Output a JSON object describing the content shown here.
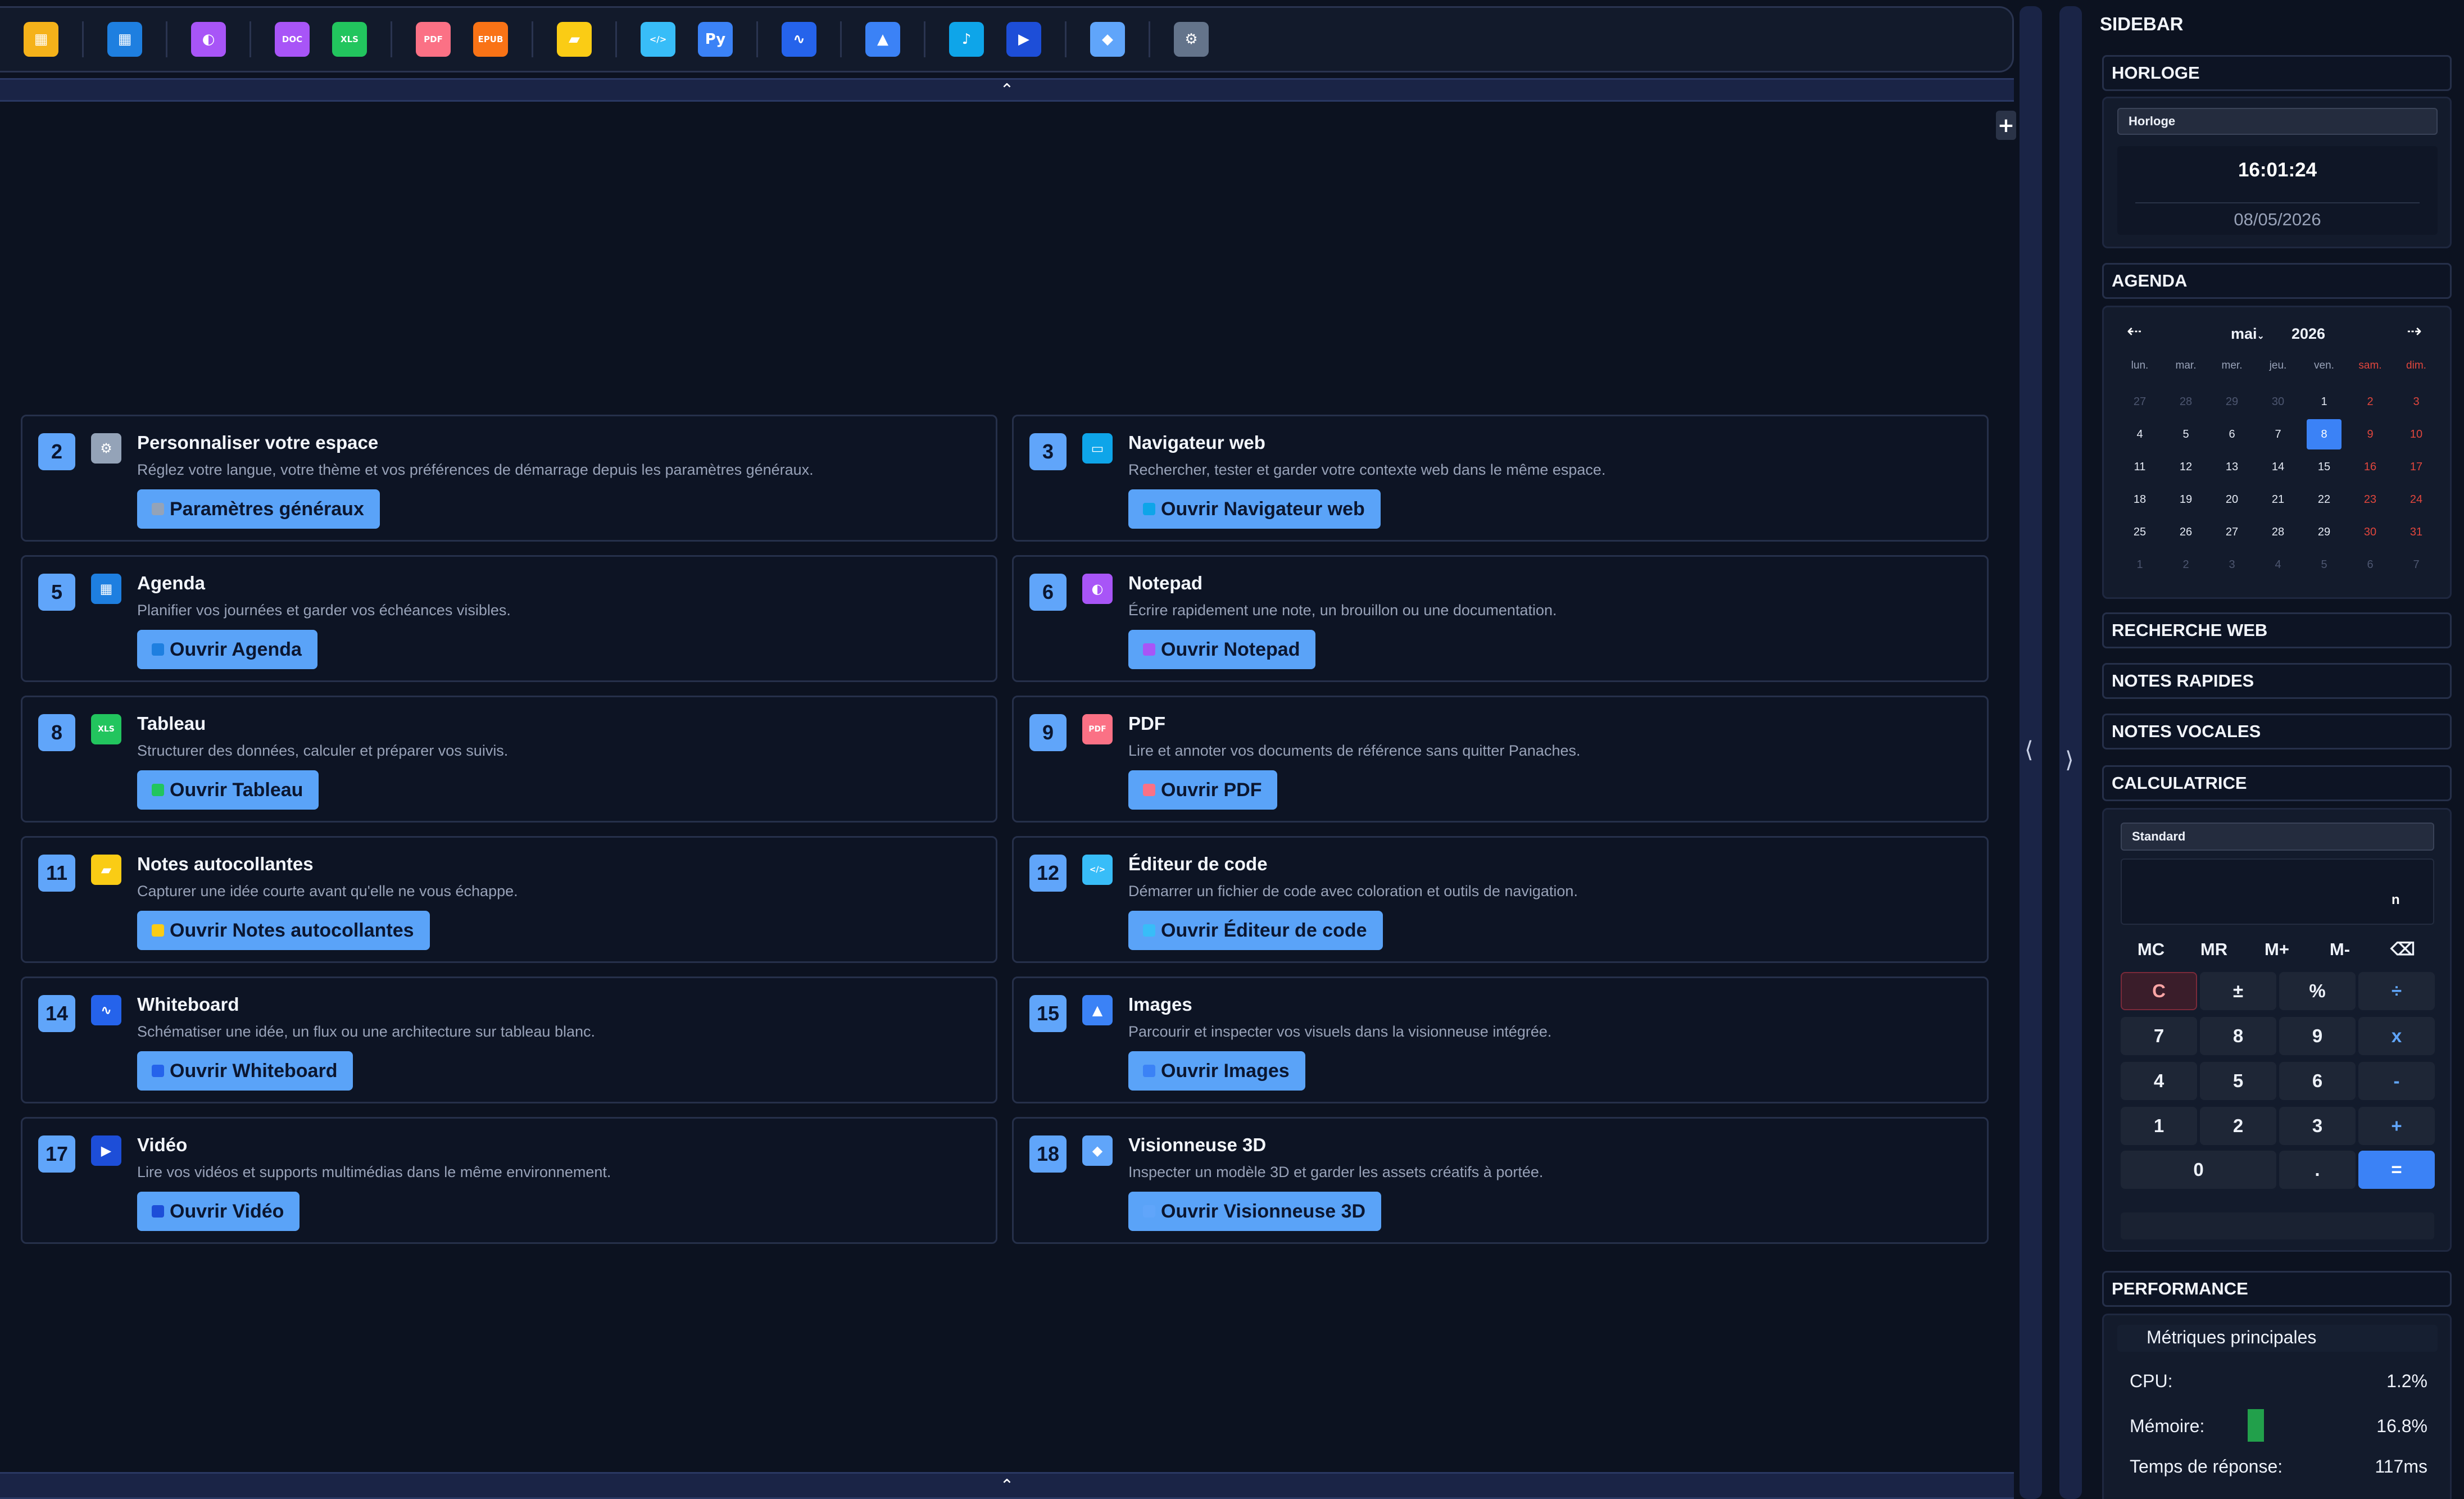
{
  "toolbar": {
    "icons": [
      {
        "name": "dashboard-app-icon",
        "glyph": "▦",
        "color": "#f5b21a"
      },
      {
        "name": "calendar-app-icon",
        "glyph": "▦",
        "color": "#1e7fe0"
      },
      {
        "name": "notepad-app-icon",
        "glyph": "◐",
        "color": "#a855f7"
      },
      {
        "name": "doc-app-icon",
        "glyph": "DOC",
        "color": "#a855f7"
      },
      {
        "name": "spreadsheet-app-icon",
        "glyph": "XLS",
        "color": "#22c55e"
      },
      {
        "name": "pdf-app-icon",
        "glyph": "PDF",
        "color": "#fb7185"
      },
      {
        "name": "epub-app-icon",
        "glyph": "EPUB",
        "color": "#f97316"
      },
      {
        "name": "sticky-note-app-icon",
        "glyph": "▰",
        "color": "#facc15"
      },
      {
        "name": "code-editor-app-icon",
        "glyph": "</>",
        "color": "#38bdf8"
      },
      {
        "name": "python-app-icon",
        "glyph": "Py",
        "color": "#3b82f6"
      },
      {
        "name": "whiteboard-app-icon",
        "glyph": "∿",
        "color": "#2563eb"
      },
      {
        "name": "images-app-icon",
        "glyph": "▲",
        "color": "#3b82f6"
      },
      {
        "name": "music-app-icon",
        "glyph": "♪",
        "color": "#0ea5e9"
      },
      {
        "name": "video-app-icon",
        "glyph": "▶",
        "color": "#1d4ed8"
      },
      {
        "name": "3d-viewer-app-icon",
        "glyph": "◆",
        "color": "#60a5fa"
      },
      {
        "name": "settings-app-icon",
        "glyph": "⚙",
        "color": "#64748b"
      }
    ],
    "collapse_glyph": "⌃",
    "expand_glyph": "+"
  },
  "cards": [
    {
      "num": "2",
      "title": "Personnaliser votre espace",
      "desc": "Réglez votre langue, votre thème et vos préférences de démarrage depuis les paramètres généraux.",
      "button": "Paramètres généraux",
      "icon": "gear-icon",
      "icon_color": "#94a3b8",
      "glyph": "⚙"
    },
    {
      "num": "3",
      "title": "Navigateur web",
      "desc": "Rechercher, tester et garder votre contexte web dans le même espace.",
      "button": "Ouvrir Navigateur web",
      "icon": "browser-icon",
      "icon_color": "#0ea5e9",
      "glyph": "▭"
    },
    {
      "num": "5",
      "title": "Agenda",
      "desc": "Planifier vos journées et garder vos échéances visibles.",
      "button": "Ouvrir Agenda",
      "icon": "calendar-icon",
      "icon_color": "#1e7fe0",
      "glyph": "▦"
    },
    {
      "num": "6",
      "title": "Notepad",
      "desc": "Écrire rapidement une note, un brouillon ou une documentation.",
      "button": "Ouvrir Notepad",
      "icon": "notepad-icon",
      "icon_color": "#a855f7",
      "glyph": "◐"
    },
    {
      "num": "8",
      "title": "Tableau",
      "desc": "Structurer des données, calculer et préparer vos suivis.",
      "button": "Ouvrir Tableau",
      "icon": "spreadsheet-icon",
      "icon_color": "#22c55e",
      "glyph": "XLS"
    },
    {
      "num": "9",
      "title": "PDF",
      "desc": "Lire et annoter vos documents de référence sans quitter Panaches.",
      "button": "Ouvrir PDF",
      "icon": "pdf-icon",
      "icon_color": "#fb7185",
      "glyph": "PDF"
    },
    {
      "num": "11",
      "title": "Notes autocollantes",
      "desc": "Capturer une idée courte avant qu'elle ne vous échappe.",
      "button": "Ouvrir Notes autocollantes",
      "icon": "sticky-note-icon",
      "icon_color": "#facc15",
      "glyph": "▰"
    },
    {
      "num": "12",
      "title": "Éditeur de code",
      "desc": "Démarrer un fichier de code avec coloration et outils de navigation.",
      "button": "Ouvrir Éditeur de code",
      "icon": "code-icon",
      "icon_color": "#38bdf8",
      "glyph": "</>"
    },
    {
      "num": "14",
      "title": "Whiteboard",
      "desc": "Schématiser une idée, un flux ou une architecture sur tableau blanc.",
      "button": "Ouvrir Whiteboard",
      "icon": "whiteboard-icon",
      "icon_color": "#2563eb",
      "glyph": "∿"
    },
    {
      "num": "15",
      "title": "Images",
      "desc": "Parcourir et inspecter vos visuels dans la visionneuse intégrée.",
      "button": "Ouvrir Images",
      "icon": "image-icon",
      "icon_color": "#3b82f6",
      "glyph": "▲"
    },
    {
      "num": "17",
      "title": "Vidéo",
      "desc": "Lire vos vidéos et supports multimédias dans le même environnement.",
      "button": "Ouvrir Vidéo",
      "icon": "video-icon",
      "icon_color": "#1d4ed8",
      "glyph": "▶"
    },
    {
      "num": "18",
      "title": "Visionneuse 3D",
      "desc": "Inspecter un modèle 3D et garder les assets créatifs à portée.",
      "button": "Ouvrir Visionneuse 3D",
      "icon": "cube-icon",
      "icon_color": "#60a5fa",
      "glyph": "◆"
    }
  ],
  "sidebar": {
    "title": "SIDEBAR",
    "rail_left_glyph": "⟨",
    "rail_right_glyph": "⟩",
    "clock": {
      "header": "HORLOGE",
      "select": "Horloge",
      "time": "16:01:24",
      "date": "08/05/2026"
    },
    "agenda": {
      "header": "AGENDA",
      "month": "mai",
      "year": "2026",
      "prev": "⇠",
      "next": "⇢",
      "dow": [
        "lun.",
        "mar.",
        "mer.",
        "jeu.",
        "ven.",
        "sam.",
        "dim."
      ],
      "days": [
        "27",
        "28",
        "29",
        "30",
        "1",
        "2",
        "3",
        "4",
        "5",
        "6",
        "7",
        "8",
        "9",
        "10",
        "11",
        "12",
        "13",
        "14",
        "15",
        "16",
        "17",
        "18",
        "19",
        "20",
        "21",
        "22",
        "23",
        "24",
        "25",
        "26",
        "27",
        "28",
        "29",
        "30",
        "31",
        "1",
        "2",
        "3",
        "4",
        "5",
        "6",
        "7"
      ],
      "today": "8"
    },
    "sections": [
      "RECHERCHE WEB",
      "NOTES RAPIDES",
      "NOTES VOCALES"
    ],
    "calculator": {
      "header": "CALCULATRICE",
      "mode": "Standard",
      "display": "n",
      "memory": [
        "MC",
        "MR",
        "M+",
        "M-",
        "⌫"
      ],
      "keys": [
        [
          "C",
          "±",
          "%",
          "÷"
        ],
        [
          "7",
          "8",
          "9",
          "x"
        ],
        [
          "4",
          "5",
          "6",
          "-"
        ],
        [
          "1",
          "2",
          "3",
          "+"
        ]
      ],
      "zero": "0",
      "dot": ".",
      "equals": "="
    },
    "performance": {
      "header": "PERFORMANCE",
      "subtitle": "Métriques principales",
      "cpu_label": "CPU:",
      "cpu_value": "1.2%",
      "mem_label": "Mémoire:",
      "mem_value": "16.8%",
      "mem_fraction": 0.168,
      "resp_label": "Temps de réponse:",
      "resp_value": "117ms"
    }
  }
}
